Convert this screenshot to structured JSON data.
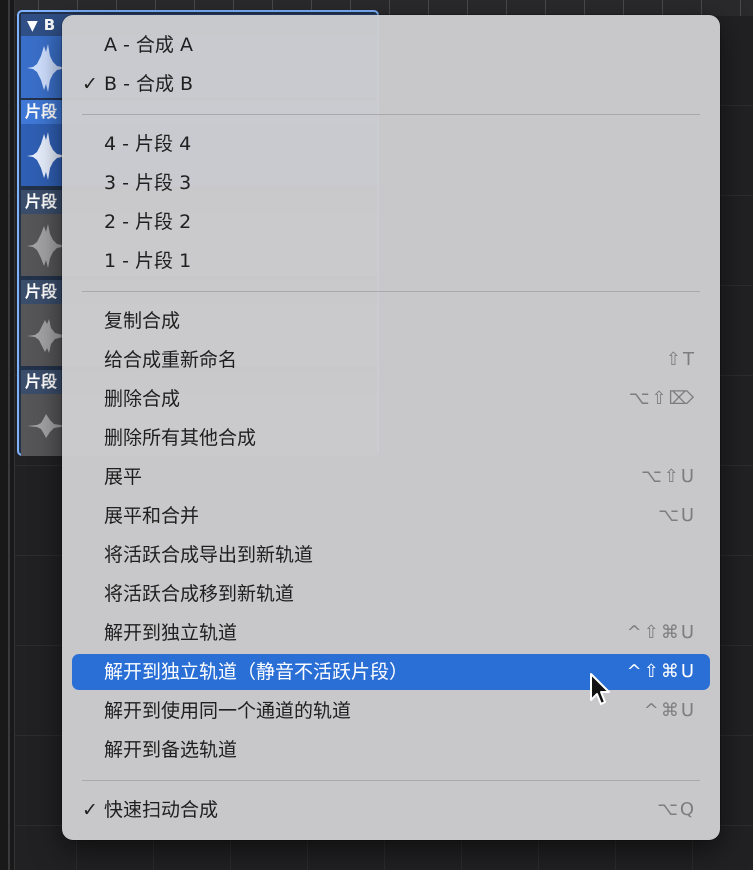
{
  "background": {
    "comp_header": {
      "symbol": "▼",
      "label": "B"
    },
    "take_label": "片段"
  },
  "menu": {
    "comps": [
      {
        "label": "A - 合成 A",
        "checked": false
      },
      {
        "label": "B - 合成 B",
        "checked": true
      }
    ],
    "takes": [
      {
        "label": "4 - 片段 4"
      },
      {
        "label": "3 - 片段 3"
      },
      {
        "label": "2 - 片段 2"
      },
      {
        "label": "1 - 片段 1"
      }
    ],
    "actions": [
      {
        "label": "复制合成",
        "shortcut": ""
      },
      {
        "label": "给合成重新命名",
        "shortcut": "⇧T"
      },
      {
        "label": "删除合成",
        "shortcut": "⌥⇧⌦"
      },
      {
        "label": "删除所有其他合成",
        "shortcut": ""
      },
      {
        "label": "展平",
        "shortcut": "⌥⇧U"
      },
      {
        "label": "展平和合并",
        "shortcut": "⌥U"
      },
      {
        "label": "将活跃合成导出到新轨道",
        "shortcut": ""
      },
      {
        "label": "将活跃合成移到新轨道",
        "shortcut": ""
      },
      {
        "label": "解开到独立轨道",
        "shortcut": "^⇧⌘U"
      },
      {
        "label": "解开到独立轨道（静音不活跃片段）",
        "shortcut": "^⇧⌘U",
        "highlighted": true
      },
      {
        "label": "解开到使用同一个通道的轨道",
        "shortcut": "^⌘U"
      },
      {
        "label": "解开到备选轨道",
        "shortcut": ""
      }
    ],
    "footer": {
      "label": "快速扫动合成",
      "shortcut": "⌥Q",
      "checked": true
    },
    "check_symbol": "✓"
  },
  "colors": {
    "highlight": "#2a6fd6",
    "menu_bg": "#cdcdcf",
    "region_active": "#3f78d6",
    "region_inactive": "#565658"
  }
}
